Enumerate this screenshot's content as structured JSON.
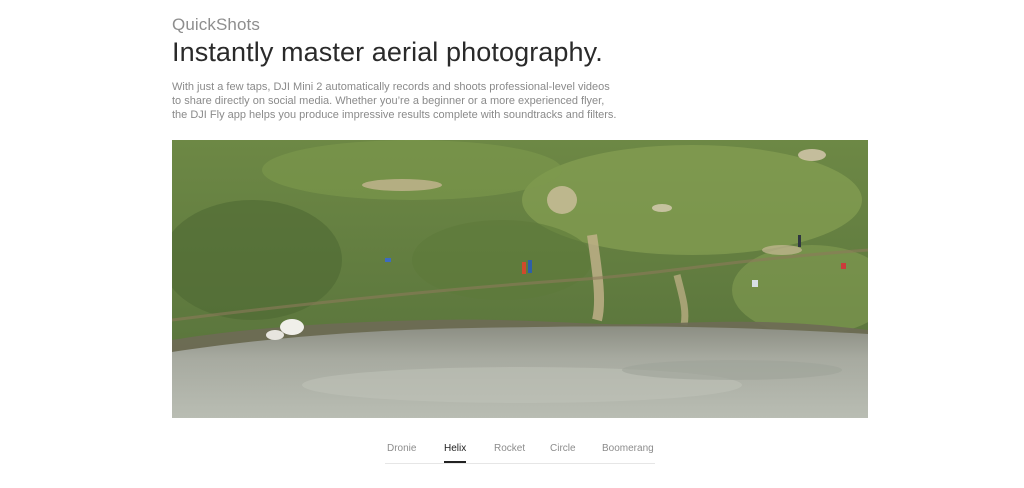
{
  "section": {
    "eyebrow": "QuickShots",
    "headline": "Instantly master aerial photography.",
    "description_lines": [
      "With just a few taps, DJI Mini 2 automatically records and shoots professional-level videos",
      "to share directly on social media. Whether you’re a beginner or a more experienced flyer,",
      "the DJI Fly app helps you produce impressive results complete with soundtracks and filters."
    ]
  },
  "hero": {
    "colors": {
      "grass": "#5f7a3d",
      "grass_light": "#7f9a4c",
      "dirt": "#c9b896",
      "water": "#a9aca2",
      "shore": "#6e6a55"
    }
  },
  "tabs": {
    "active": "Helix",
    "items": [
      {
        "label": "Dronie"
      },
      {
        "label": "Helix"
      },
      {
        "label": "Rocket"
      },
      {
        "label": "Circle"
      },
      {
        "label": "Boomerang"
      }
    ]
  }
}
